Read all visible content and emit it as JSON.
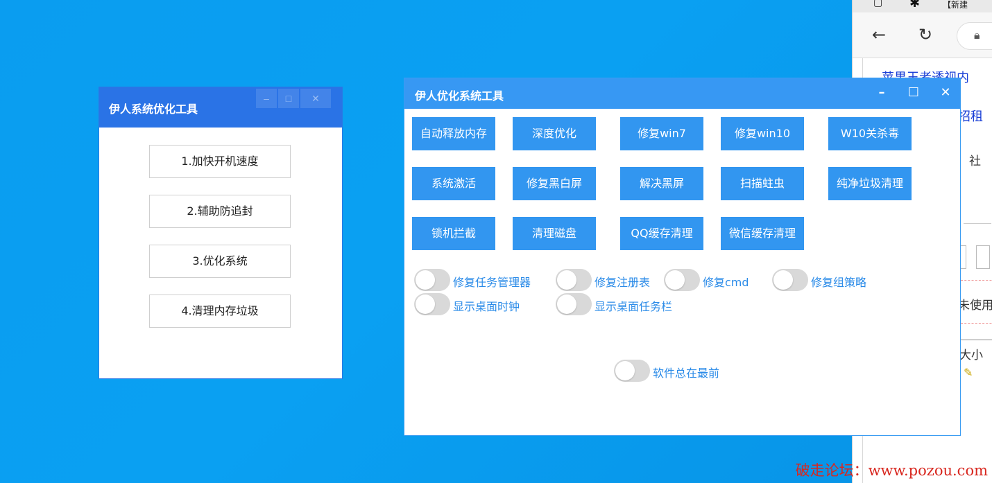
{
  "browser": {
    "tab_title": "【新建",
    "line1": "苹果王者透视内",
    "line2": "招租",
    "line3": "社",
    "line4": "未使用",
    "line5": "大小"
  },
  "small_window": {
    "title": "伊人系统优化工具",
    "controls": {
      "minimize": "–",
      "maximize": "□",
      "close": "✕"
    },
    "buttons": [
      "1.加快开机速度",
      "2.辅助防追封",
      "3.优化系统",
      "4.清理内存垃圾"
    ]
  },
  "main_window": {
    "title": "伊人优化系统工具",
    "controls": {
      "minimize": "–",
      "maximize": "☐",
      "close": "✕"
    },
    "buttons": [
      [
        "自动释放内存",
        "深度优化",
        "修复win7",
        "修复win10",
        "W10关杀毒"
      ],
      [
        "系统激活",
        "修复黑白屏",
        "解决黑屏",
        "扫描蛀虫",
        "纯净垃圾清理"
      ],
      [
        "锁机拦截",
        "清理磁盘",
        "QQ缓存清理",
        "微信缓存清理"
      ]
    ],
    "toggles": [
      {
        "label": "修复任务管理器",
        "on": false
      },
      {
        "label": "修复注册表",
        "on": false
      },
      {
        "label": "修复cmd",
        "on": false
      },
      {
        "label": "修复组策略",
        "on": false
      },
      {
        "label": "显示桌面时钟",
        "on": false
      },
      {
        "label": "显示桌面任务栏",
        "on": false
      }
    ],
    "topmost_toggle": {
      "label": "软件总在最前",
      "on": false
    }
  },
  "watermark": "破走论坛：www.pozou.com",
  "colors": {
    "desktop": "#0a9df0",
    "small_titlebar": "#2a73e6",
    "main_titlebar": "#3798f3",
    "tool_button": "#3296f0",
    "toggle_label": "#2b8be8",
    "watermark": "#d8271f"
  }
}
